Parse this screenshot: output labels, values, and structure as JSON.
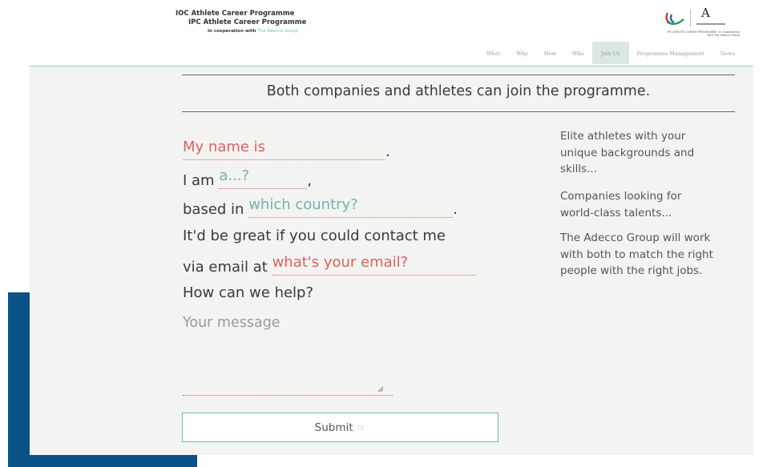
{
  "header": {
    "logo_line1": "IOC Athlete Career Programme",
    "logo_line2": "IPC Athlete Career Programme",
    "logo_line3_prefix": "In cooperation with ",
    "logo_line3_partner": "The Adecco Group",
    "brand_letter": "A",
    "brand_tagline": "IPC ATHLETE CAREER PROGRAMME · In Cooperation with The Adecco Group",
    "nav": [
      {
        "label": "What"
      },
      {
        "label": "Why"
      },
      {
        "label": "How"
      },
      {
        "label": "Who"
      },
      {
        "label": "Join Us",
        "active": true
      },
      {
        "label": "Programme Management"
      },
      {
        "label": "News"
      }
    ]
  },
  "main": {
    "heading": "Both companies and athletes can join the programme.",
    "form": {
      "name_placeholder": "My name is",
      "name_suffix": ".",
      "iam_prefix": "I am ",
      "role_placeholder": "a...?",
      "role_suffix": ",",
      "based_prefix": "based in ",
      "country_placeholder": "which country?",
      "country_suffix": ".",
      "contact_line": "It'd be great if you could contact me",
      "email_prefix": "via email at ",
      "email_placeholder": "what's your email?",
      "help_line": "How can we help?",
      "message_placeholder": "Your message",
      "submit_label": "Submit",
      "submit_icon": "☞"
    },
    "side": {
      "p1": [
        "Elite athletes with your",
        "unique backgrounds and",
        "skills..."
      ],
      "p2": [
        "Companies looking for",
        "world-class talents..."
      ],
      "p3": [
        "The Adecco Group will work",
        "with both to match the right",
        "people with the right jobs."
      ]
    }
  },
  "colors": {
    "accent_teal": "#6bbfb0",
    "accent_red": "#d9625f",
    "deco_blue": "#0a5288"
  }
}
